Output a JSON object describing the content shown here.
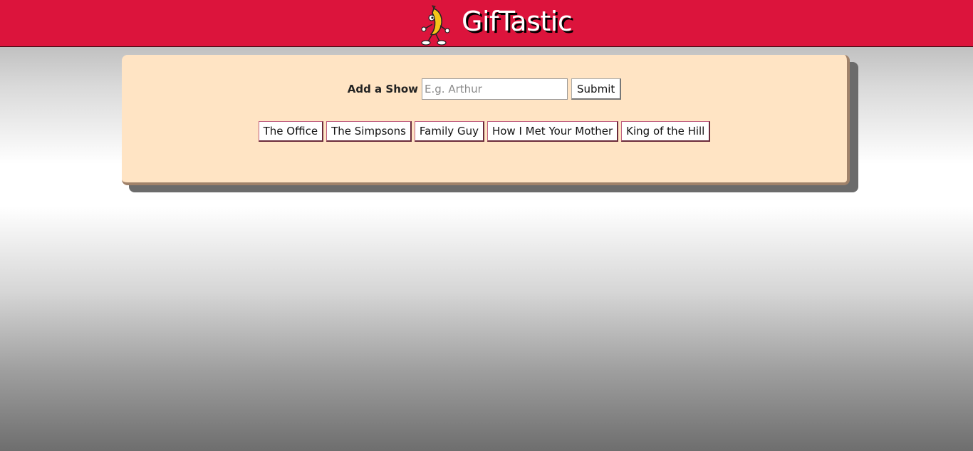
{
  "header": {
    "title": "GifTastic",
    "logo_icon": "dancing-banana-icon",
    "background_color": "#dc143c"
  },
  "form": {
    "label": "Add a Show",
    "input_placeholder": "E.g. Arthur",
    "input_value": "",
    "submit_label": "Submit"
  },
  "shows": [
    {
      "label": "The Office"
    },
    {
      "label": "The Simpsons"
    },
    {
      "label": "Family Guy"
    },
    {
      "label": "How I Met Your Mother"
    },
    {
      "label": "King of the Hill"
    }
  ],
  "colors": {
    "panel": "#ffe4c4",
    "accent": "#dc143c"
  }
}
